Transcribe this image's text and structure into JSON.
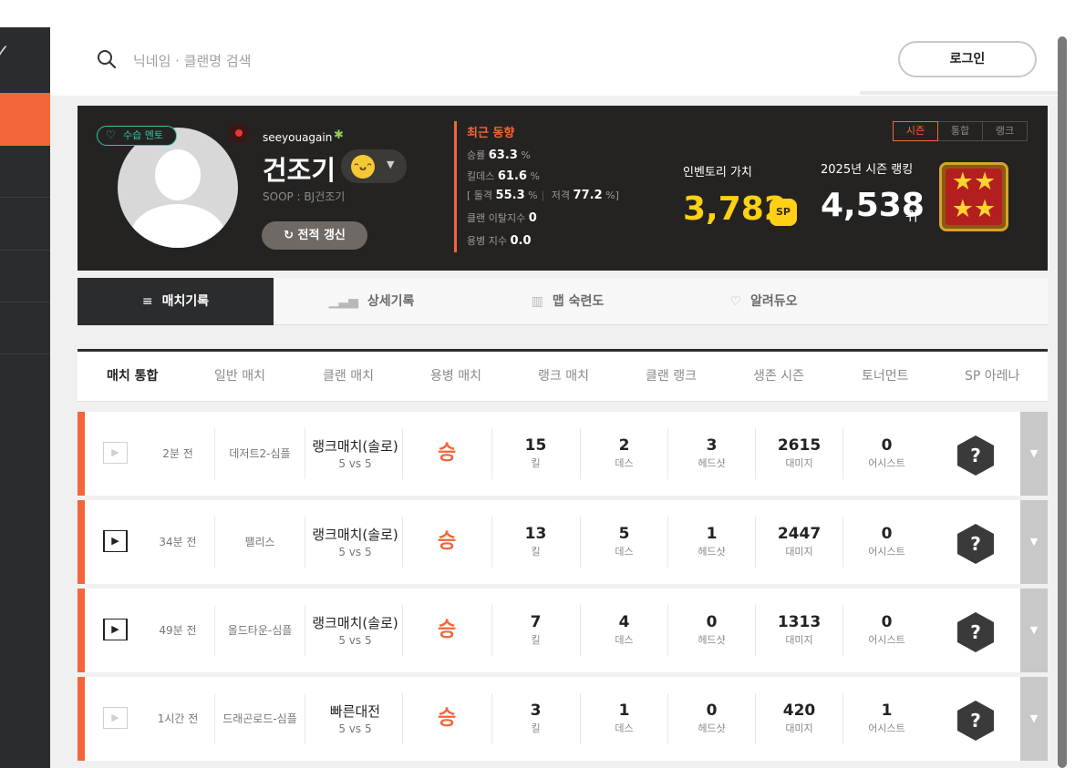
{
  "search": {
    "placeholder": "닉네임 · 클랜명 검색"
  },
  "header": {
    "login_label": "로그인"
  },
  "profile": {
    "badge": "수습 멘토",
    "user_id": "seeyouagain",
    "name": "건조기",
    "platform": "SOOP : BJ건조기",
    "refresh_label": "전적 갱신",
    "recent": {
      "title": "최근 동향",
      "win_rate_label": "승률",
      "win_rate": "63.3",
      "pct": "%",
      "kd_label": "킬데스",
      "kd": "61.6",
      "assault_label": "돌격",
      "assault": "55.3",
      "sniper_label": "저격",
      "sniper": "77.2",
      "clan_leave_label": "클랜 이탈지수",
      "clan_leave": "0",
      "merc_label": "용병 지수",
      "merc": "0.0"
    },
    "inventory": {
      "label": "인벤토리 가치",
      "value": "3,782",
      "sp": "SP"
    },
    "ranking": {
      "label": "2025년 시즌 랭킹",
      "value": "4,538",
      "unit": "위",
      "tabs": [
        "시즌",
        "통합",
        "랭크"
      ]
    }
  },
  "tabs": [
    "매치기록",
    "상세기록",
    "맵 숙련도",
    "알려듀오"
  ],
  "filters": [
    "매치 통합",
    "일반 매치",
    "클랜 매치",
    "용병 매치",
    "랭크 매치",
    "클랜 랭크",
    "생존 시즌",
    "토너먼트",
    "SP 아레나"
  ],
  "stat_labels": {
    "kill": "킬",
    "death": "데스",
    "headshot": "헤드샷",
    "damage": "대미지",
    "assist": "어시스트"
  },
  "matches": [
    {
      "time": "2분 전",
      "map": "데저트2-심플",
      "mode": "랭크매치(솔로)",
      "teams": "5 vs 5",
      "result": "승",
      "kill": "15",
      "death": "2",
      "headshot": "3",
      "damage": "2615",
      "assist": "0",
      "hex": "?",
      "replay_dark": false
    },
    {
      "time": "34분 전",
      "map": "팰리스",
      "mode": "랭크매치(솔로)",
      "teams": "5 vs 5",
      "result": "승",
      "kill": "13",
      "death": "5",
      "headshot": "1",
      "damage": "2447",
      "assist": "0",
      "hex": "?",
      "replay_dark": true
    },
    {
      "time": "49분 전",
      "map": "올드타운-심플",
      "mode": "랭크매치(솔로)",
      "teams": "5 vs 5",
      "result": "승",
      "kill": "7",
      "death": "4",
      "headshot": "0",
      "damage": "1313",
      "assist": "0",
      "hex": "?",
      "replay_dark": true
    },
    {
      "time": "1시간 전",
      "map": "드래곤로드-심플",
      "mode": "빠른대전",
      "teams": "5 vs 5",
      "result": "승",
      "kill": "3",
      "death": "1",
      "headshot": "0",
      "damage": "420",
      "assist": "1",
      "hex": "?",
      "replay_dark": false
    }
  ],
  "colors": {
    "accent": "#f2663a",
    "gold": "#ffd014",
    "mentor": "#2fc7a6",
    "dark": "#2a2c2e"
  }
}
